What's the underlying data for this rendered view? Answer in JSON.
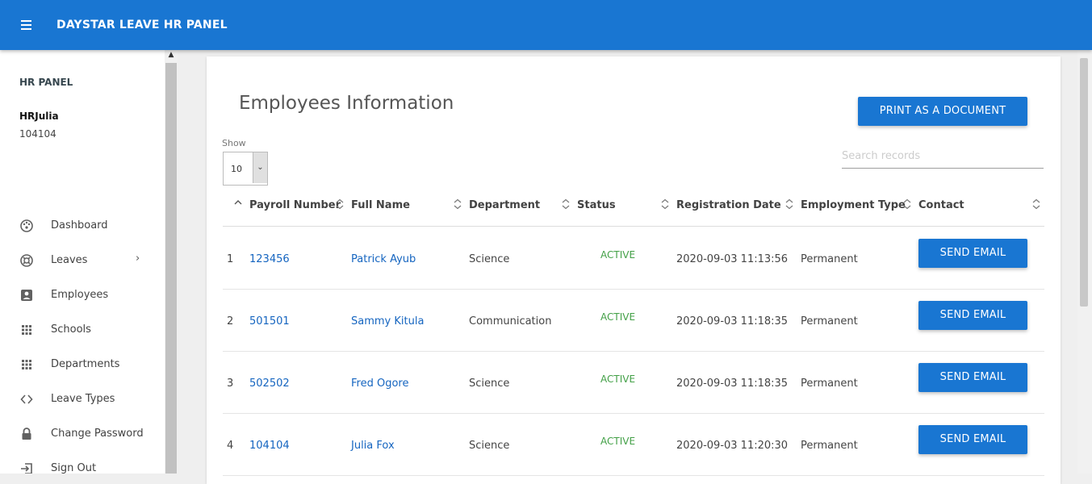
{
  "header": {
    "title": "DAYSTAR LEAVE HR PANEL"
  },
  "sidebar": {
    "panel_title": "HR PANEL",
    "user_name": "HRJulia",
    "user_id": "104104",
    "items": [
      {
        "label": "Dashboard",
        "icon": "dashboard-icon"
      },
      {
        "label": "Leaves",
        "icon": "leaves-icon"
      },
      {
        "label": "Employees",
        "icon": "employees-icon"
      },
      {
        "label": "Schools",
        "icon": "schools-icon"
      },
      {
        "label": "Departments",
        "icon": "departments-icon"
      },
      {
        "label": "Leave Types",
        "icon": "code-icon"
      },
      {
        "label": "Change Password",
        "icon": "lock-icon"
      },
      {
        "label": "Sign Out",
        "icon": "sign-out-icon"
      }
    ]
  },
  "main": {
    "title": "Employees Information",
    "print_label": "PRINT AS A DOCUMENT",
    "show_label": "Show",
    "show_value": "10",
    "search_placeholder": "Search records",
    "columns": [
      "Payroll Number",
      "Full Name",
      "Department",
      "Status",
      "Registration Date",
      "Employment Type",
      "Contact"
    ],
    "rows": [
      {
        "index": "1",
        "payroll": "123456",
        "name": "Patrick Ayub",
        "department": "Science",
        "status": "ACTIVE",
        "date": "2020-09-03 11:13:56",
        "type": "Permanent",
        "action": "SEND EMAIL"
      },
      {
        "index": "2",
        "payroll": "501501",
        "name": "Sammy Kitula",
        "department": "Communication",
        "status": "ACTIVE",
        "date": "2020-09-03 11:18:35",
        "type": "Permanent",
        "action": "SEND EMAIL"
      },
      {
        "index": "3",
        "payroll": "502502",
        "name": "Fred Ogore",
        "department": "Science",
        "status": "ACTIVE",
        "date": "2020-09-03 11:18:35",
        "type": "Permanent",
        "action": "SEND EMAIL"
      },
      {
        "index": "4",
        "payroll": "104104",
        "name": "Julia Fox",
        "department": "Science",
        "status": "ACTIVE",
        "date": "2020-09-03 11:20:30",
        "type": "Permanent",
        "action": "SEND EMAIL"
      }
    ]
  },
  "colors": {
    "primary": "#1976d2",
    "active": "#43a047",
    "link": "#1565c0"
  }
}
